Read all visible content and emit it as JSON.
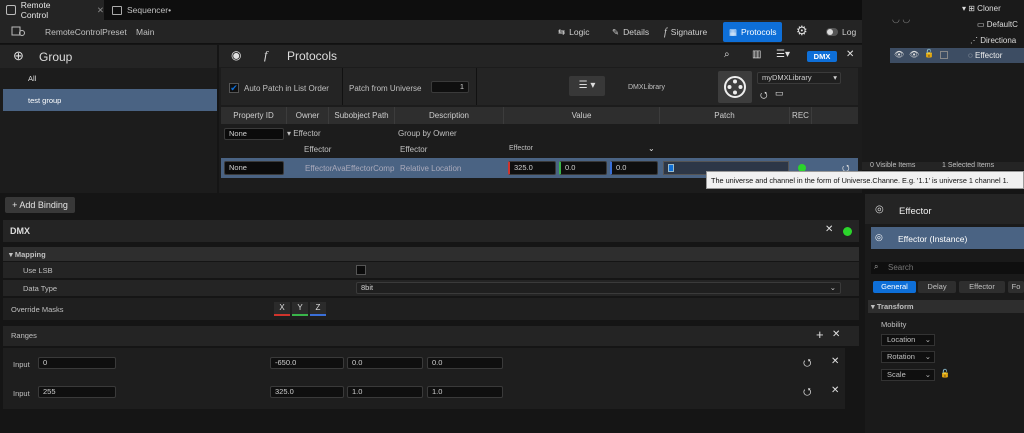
{
  "tabs": [
    {
      "label": "Remote Control"
    },
    {
      "label": "Sequencer•"
    }
  ],
  "toolbar": {
    "preset_label": "RemoteControlPreset",
    "main_label": "Main",
    "logic": "Logic",
    "details": "Details",
    "signature": "Signature",
    "protocols": "Protocols",
    "log": "Log"
  },
  "group_panel": {
    "title": "Group",
    "items": [
      {
        "label": "All"
      },
      {
        "label": "test group"
      }
    ]
  },
  "protocols_panel": {
    "title": "Protocols",
    "badge": "DMX",
    "auto_patch_label": "Auto Patch in List Order",
    "patch_from_universe_label": "Patch from Universe",
    "patch_from_universe_value": "1",
    "library_label": "DMXLibrary",
    "library_value": "myDMXLibrary",
    "columns": [
      "Property ID",
      "Owner",
      "Subobject Path",
      "Description",
      "Value",
      "Patch",
      "REC"
    ],
    "group_row": {
      "property_id": "None",
      "owner": "Effector",
      "description": "Group by Owner"
    },
    "sub_row": {
      "owner": "Effector",
      "description": "Effector",
      "value_label": "Effector"
    },
    "binding_row": {
      "property_id": "None",
      "owner": "Effector",
      "subobject": "AvaEffectorComp",
      "description": "Relative Location",
      "x": "325.0",
      "y": "0.0",
      "z": "0.0"
    },
    "tooltip": "The universe and channel in the form of Universe.Channe. E.g. '1.1' is universe 1 channel 1."
  },
  "binding_panel": {
    "add_binding": "+ Add Binding",
    "dmx_title": "DMX",
    "mapping_label": "Mapping",
    "use_lsb_label": "Use LSB",
    "data_type_label": "Data Type",
    "data_type_value": "8bit",
    "override_masks_label": "Override Masks",
    "mask_x": "X",
    "mask_y": "Y",
    "mask_z": "Z",
    "ranges_label": "Ranges",
    "ranges": [
      {
        "label": "Input",
        "input": "0",
        "x": "-650.0",
        "y": "0.0",
        "z": "0.0"
      },
      {
        "label": "Input",
        "input": "255",
        "x": "325.0",
        "y": "1.0",
        "z": "1.0"
      }
    ]
  },
  "outliner": {
    "items": [
      {
        "label": "Cloner"
      },
      {
        "label": "DefaultC"
      },
      {
        "label": "Directiona"
      },
      {
        "label": "Effector"
      }
    ],
    "visible_items": "0 Visible Items",
    "selected_items": "1 Selected Items"
  },
  "details": {
    "title": "Effector",
    "instance": "Effector (Instance)",
    "search_placeholder": "Search",
    "tabs": [
      "General",
      "Delay",
      "Effector",
      "Fo"
    ],
    "transform_label": "Transform",
    "mobility_label": "Mobility",
    "location": "Location",
    "rotation": "Rotation",
    "scale": "Scale"
  },
  "colors": {
    "accent": "#0e6fd8",
    "green": "#2bd52b",
    "red_axis": "#d0342c",
    "green_axis": "#39b54a",
    "blue_axis": "#3a6fd8"
  }
}
